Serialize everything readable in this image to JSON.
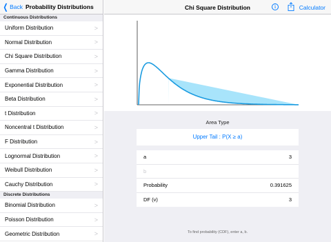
{
  "sidebar": {
    "back_label": "Back",
    "title": "Probability Distributions",
    "continuous_header": "Continuous Distributions",
    "continuous_items": [
      "Uniform Distribution",
      "Normal Distribution",
      "Chi Square Distribution",
      "Gamma Distribution",
      "Exponential Distribution",
      "Beta Distribution",
      "t Distribution",
      "Noncentral t Distribution",
      "F Distribution",
      "Lognormal Distribution",
      "Weibull Distribution",
      "Cauchy Distribution"
    ],
    "discrete_header": "Discrete Distributions",
    "discrete_items": [
      "Binomial Distribution",
      "Poisson Distribution",
      "Geometric Distribution"
    ]
  },
  "main": {
    "title": "Chi Square Distribution",
    "calculator_label": "Calculator",
    "info_icon": "info-icon",
    "share_icon": "share-icon",
    "area_type_label": "Area Type",
    "area_type_value": "Upper Tail : P(X ≥ a)",
    "params": {
      "a_label": "a",
      "a_value": "3",
      "b_placeholder": "b",
      "probability_label": "Probability",
      "probability_value": "0.391625",
      "df_label": "DF (v)",
      "df_value": "3"
    },
    "footnote": "To find probability (CDF), enter a, b."
  },
  "colors": {
    "accent": "#007aff",
    "curve": "#1a9be0",
    "fill": "#a8e4fb"
  }
}
